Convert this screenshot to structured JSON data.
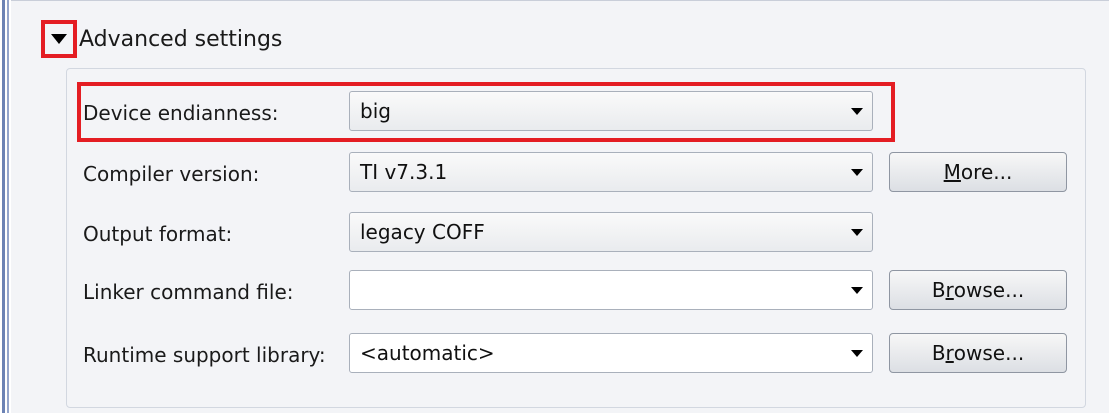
{
  "section": {
    "title": "Advanced settings",
    "expanded": true,
    "twisty_icon": "triangle-down-icon"
  },
  "rows": [
    {
      "label": "Device endianness:",
      "value": "big",
      "editable": false
    },
    {
      "label": "Compiler version:",
      "value": "TI v7.3.1",
      "editable": false,
      "button": {
        "mnemonic": "M",
        "rest": "ore..."
      }
    },
    {
      "label": "Output format:",
      "value": "legacy COFF",
      "editable": false
    },
    {
      "label": "Linker command file:",
      "value": "",
      "editable": true,
      "button": {
        "pre": "B",
        "mnemonic": "r",
        "rest": "owse..."
      }
    },
    {
      "label": "Runtime support library:",
      "value": "<automatic>",
      "editable": true,
      "button": {
        "pre": "B",
        "mnemonic": "r",
        "rest": "owse..."
      }
    }
  ],
  "colors": {
    "highlight": "#e41d23",
    "panel_bg": "#f3f4f7",
    "rail": "#6c83b5"
  }
}
